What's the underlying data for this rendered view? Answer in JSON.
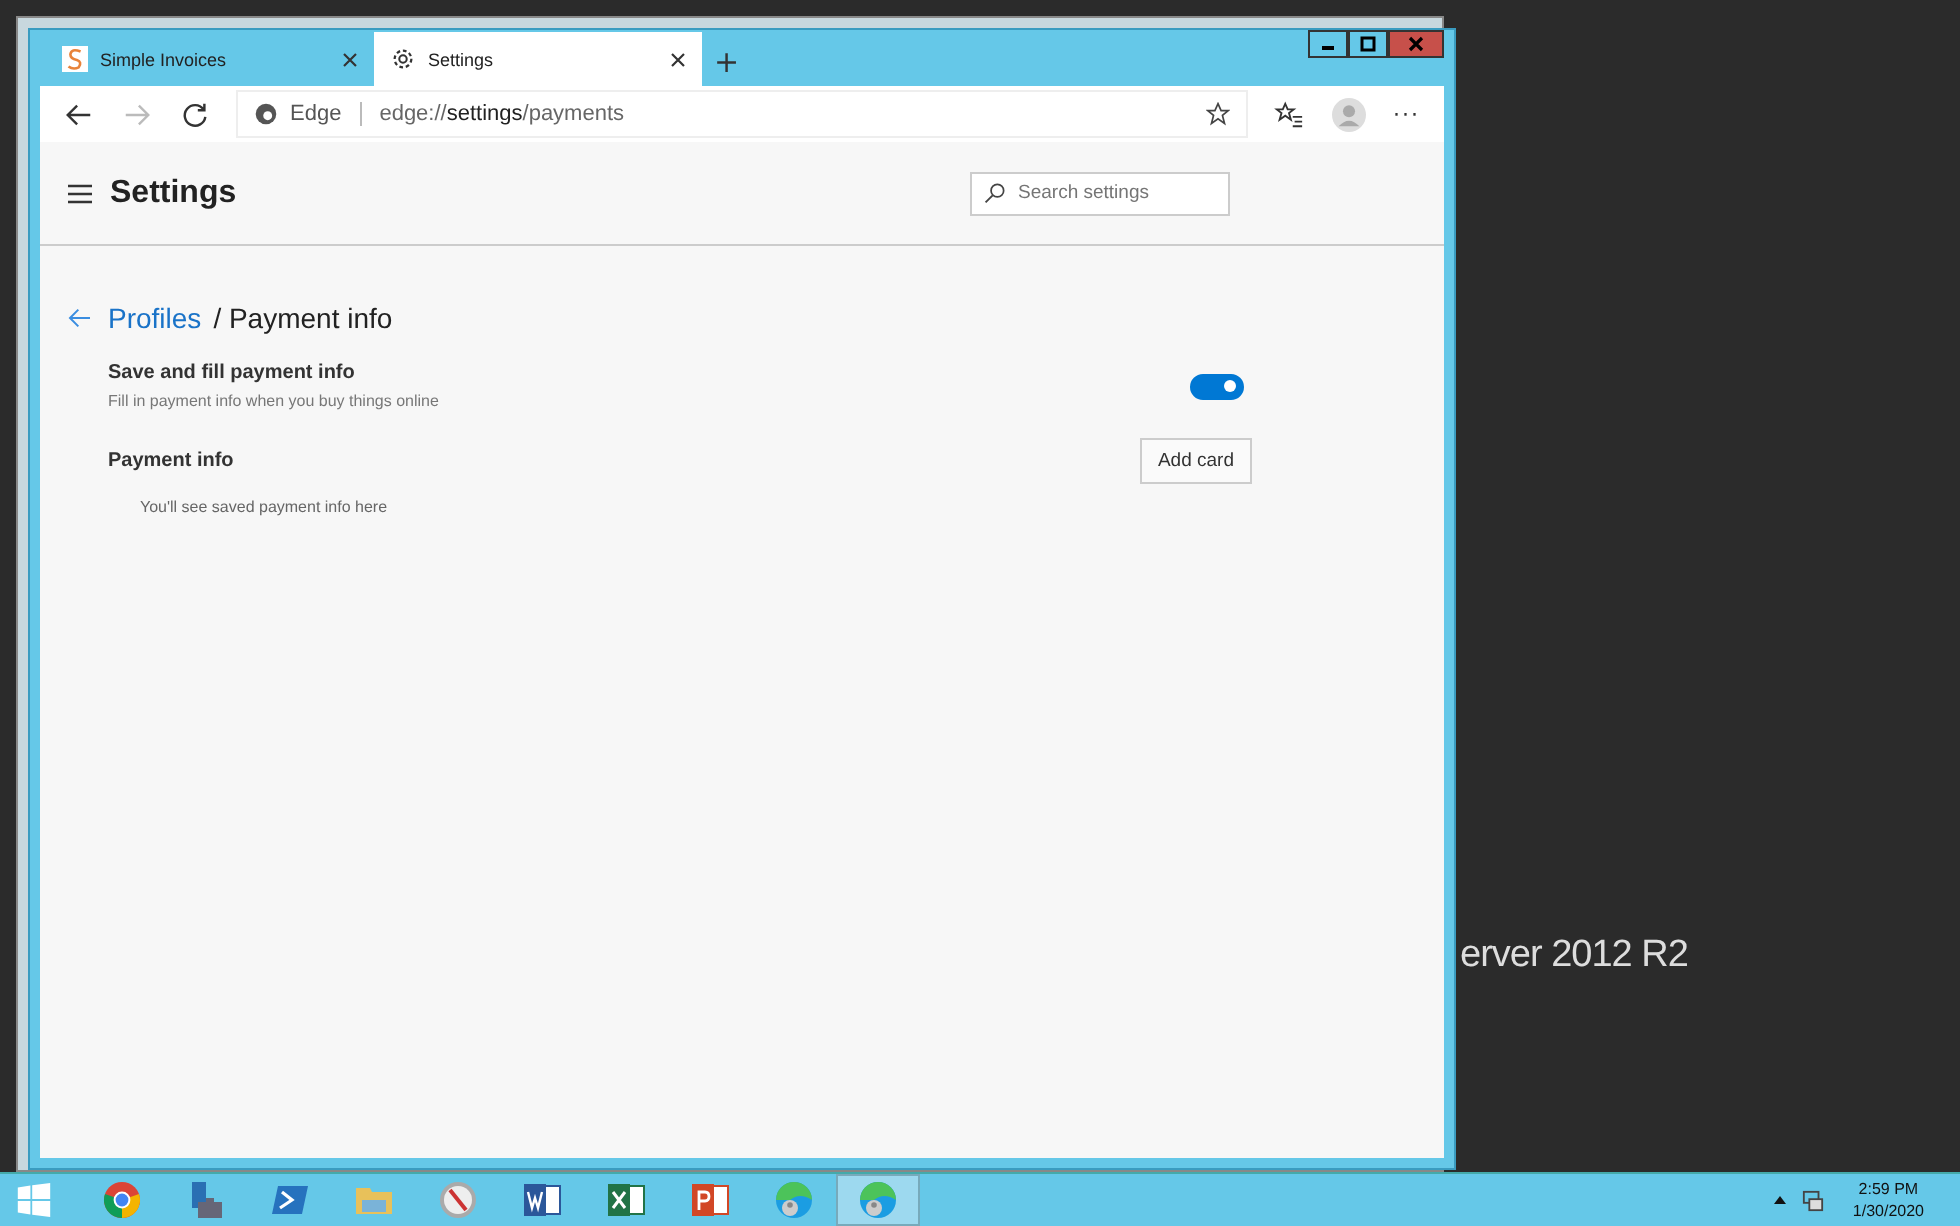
{
  "desktop": {
    "text": "erver 2012 R2"
  },
  "browser": {
    "tabs": [
      {
        "title": "Simple Invoices",
        "kind": "site",
        "selected": false
      },
      {
        "title": "Settings",
        "kind": "settings",
        "selected": true
      }
    ],
    "new_tab": "+",
    "address": {
      "label": "Edge",
      "url_prefix": "edge://",
      "url_host": "settings",
      "url_path": "/payments"
    },
    "more": "···"
  },
  "settings": {
    "title": "Settings",
    "search": {
      "placeholder": "Search settings"
    },
    "breadcrumb": {
      "parent": "Profiles",
      "separator": "/",
      "current": "Payment info"
    },
    "toggle_row": {
      "label": "Save and fill payment info",
      "description": "Fill in payment info when you buy things online",
      "on": true
    },
    "payment": {
      "label": "Payment info",
      "button": "Add card",
      "empty": "You'll see saved payment info here"
    }
  },
  "taskbar": {
    "apps": [
      {
        "kind": "chrome",
        "selected": false
      },
      {
        "kind": "server",
        "selected": false
      },
      {
        "kind": "powershell",
        "selected": false
      },
      {
        "kind": "folder",
        "selected": false
      },
      {
        "kind": "compass",
        "selected": false
      },
      {
        "kind": "word",
        "selected": false
      },
      {
        "kind": "excel",
        "selected": false
      },
      {
        "kind": "powerpoint",
        "selected": false
      },
      {
        "kind": "edge",
        "selected": false
      },
      {
        "kind": "edge",
        "selected": true
      }
    ],
    "time": "2:59 PM",
    "date": "1/30/2020"
  }
}
